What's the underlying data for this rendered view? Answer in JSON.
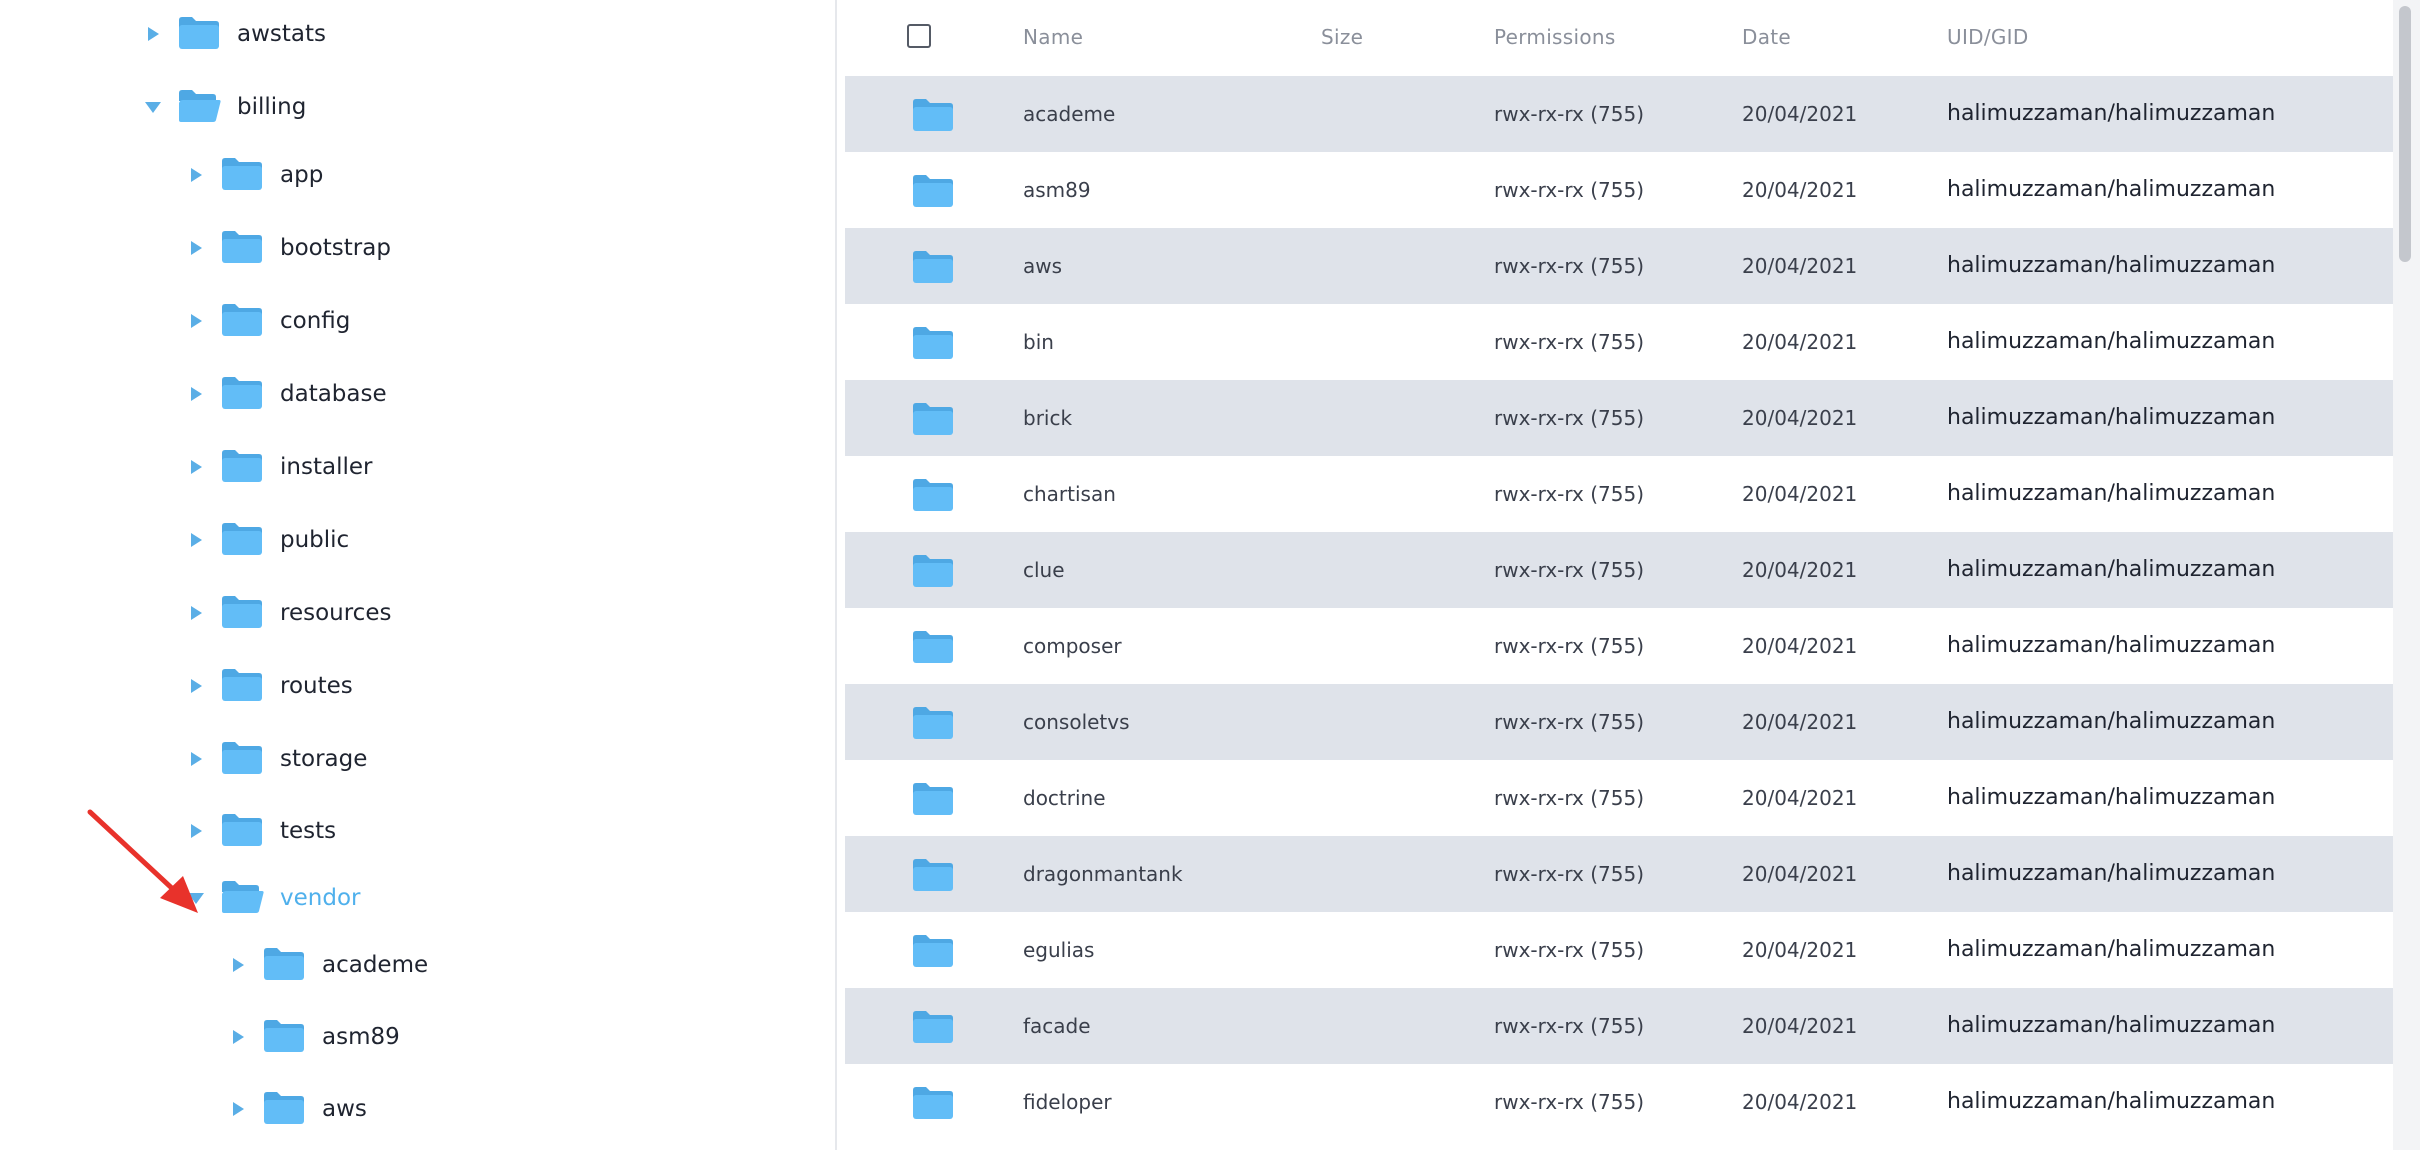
{
  "tree": {
    "nodes": [
      {
        "label": "awstats",
        "level": 0,
        "expanded": false
      },
      {
        "label": "billing",
        "level": 0,
        "expanded": true
      },
      {
        "label": "app",
        "level": 1,
        "expanded": false
      },
      {
        "label": "bootstrap",
        "level": 1,
        "expanded": false
      },
      {
        "label": "config",
        "level": 1,
        "expanded": false
      },
      {
        "label": "database",
        "level": 1,
        "expanded": false
      },
      {
        "label": "installer",
        "level": 1,
        "expanded": false
      },
      {
        "label": "public",
        "level": 1,
        "expanded": false
      },
      {
        "label": "resources",
        "level": 1,
        "expanded": false
      },
      {
        "label": "routes",
        "level": 1,
        "expanded": false
      },
      {
        "label": "storage",
        "level": 1,
        "expanded": false
      },
      {
        "label": "tests",
        "level": 1,
        "expanded": false
      },
      {
        "label": "vendor",
        "level": 1,
        "expanded": true,
        "selected": true
      },
      {
        "label": "academe",
        "level": 2,
        "expanded": false
      },
      {
        "label": "asm89",
        "level": 2,
        "expanded": false
      },
      {
        "label": "aws",
        "level": 2,
        "expanded": false
      }
    ]
  },
  "table": {
    "headers": {
      "name": "Name",
      "size": "Size",
      "permissions": "Permissions",
      "date": "Date",
      "uid_gid": "UID/GID"
    },
    "rows": [
      {
        "name": "academe",
        "size": "",
        "permissions": "rwx-rx-rx (755)",
        "date": "20/04/2021",
        "owner": "halimuzzaman/halimuzzaman"
      },
      {
        "name": "asm89",
        "size": "",
        "permissions": "rwx-rx-rx (755)",
        "date": "20/04/2021",
        "owner": "halimuzzaman/halimuzzaman"
      },
      {
        "name": "aws",
        "size": "",
        "permissions": "rwx-rx-rx (755)",
        "date": "20/04/2021",
        "owner": "halimuzzaman/halimuzzaman"
      },
      {
        "name": "bin",
        "size": "",
        "permissions": "rwx-rx-rx (755)",
        "date": "20/04/2021",
        "owner": "halimuzzaman/halimuzzaman"
      },
      {
        "name": "brick",
        "size": "",
        "permissions": "rwx-rx-rx (755)",
        "date": "20/04/2021",
        "owner": "halimuzzaman/halimuzzaman"
      },
      {
        "name": "chartisan",
        "size": "",
        "permissions": "rwx-rx-rx (755)",
        "date": "20/04/2021",
        "owner": "halimuzzaman/halimuzzaman"
      },
      {
        "name": "clue",
        "size": "",
        "permissions": "rwx-rx-rx (755)",
        "date": "20/04/2021",
        "owner": "halimuzzaman/halimuzzaman"
      },
      {
        "name": "composer",
        "size": "",
        "permissions": "rwx-rx-rx (755)",
        "date": "20/04/2021",
        "owner": "halimuzzaman/halimuzzaman"
      },
      {
        "name": "consoletvs",
        "size": "",
        "permissions": "rwx-rx-rx (755)",
        "date": "20/04/2021",
        "owner": "halimuzzaman/halimuzzaman"
      },
      {
        "name": "doctrine",
        "size": "",
        "permissions": "rwx-rx-rx (755)",
        "date": "20/04/2021",
        "owner": "halimuzzaman/halimuzzaman"
      },
      {
        "name": "dragonmantank",
        "size": "",
        "permissions": "rwx-rx-rx (755)",
        "date": "20/04/2021",
        "owner": "halimuzzaman/halimuzzaman"
      },
      {
        "name": "egulias",
        "size": "",
        "permissions": "rwx-rx-rx (755)",
        "date": "20/04/2021",
        "owner": "halimuzzaman/halimuzzaman"
      },
      {
        "name": "facade",
        "size": "",
        "permissions": "rwx-rx-rx (755)",
        "date": "20/04/2021",
        "owner": "halimuzzaman/halimuzzaman"
      },
      {
        "name": "fideloper",
        "size": "",
        "permissions": "rwx-rx-rx (755)",
        "date": "20/04/2021",
        "owner": "halimuzzaman/halimuzzaman"
      }
    ]
  },
  "colors": {
    "accent": "#4fb0ec",
    "folder": "#62bdf7",
    "folder_dark": "#4ea8e4",
    "row_shade": "#dfe3ea",
    "arrow": "#e8322b"
  },
  "icons": {
    "folder": "folder-icon",
    "folder_open": "folder-open-icon",
    "expand": "caret-right-icon",
    "collapse": "caret-down-icon"
  }
}
